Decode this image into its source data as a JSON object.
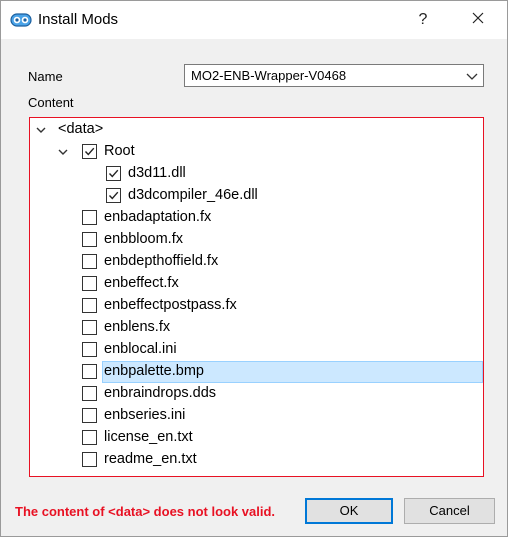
{
  "window": {
    "title": "Install Mods",
    "help_glyph": "?",
    "icon": "mo2-app-icon",
    "close_icon": "close-icon"
  },
  "form": {
    "name_label": "Name",
    "name_value": "MO2-ENB-Wrapper-V0468",
    "content_label": "Content"
  },
  "tree": {
    "items": [
      {
        "label": "<data>",
        "level": 0,
        "expandable": true,
        "expanded": true,
        "checkbox": false
      },
      {
        "label": "Root",
        "level": 1,
        "expandable": true,
        "expanded": true,
        "checkbox": true,
        "checked": true
      },
      {
        "label": "d3d11.dll",
        "level": 2,
        "expandable": false,
        "checkbox": true,
        "checked": true
      },
      {
        "label": "d3dcompiler_46e.dll",
        "level": 2,
        "expandable": false,
        "checkbox": true,
        "checked": true
      },
      {
        "label": "enbadaptation.fx",
        "level": 1,
        "expandable": false,
        "checkbox": true,
        "checked": false
      },
      {
        "label": "enbbloom.fx",
        "level": 1,
        "expandable": false,
        "checkbox": true,
        "checked": false
      },
      {
        "label": "enbdepthoffield.fx",
        "level": 1,
        "expandable": false,
        "checkbox": true,
        "checked": false
      },
      {
        "label": "enbeffect.fx",
        "level": 1,
        "expandable": false,
        "checkbox": true,
        "checked": false
      },
      {
        "label": "enbeffectpostpass.fx",
        "level": 1,
        "expandable": false,
        "checkbox": true,
        "checked": false
      },
      {
        "label": "enblens.fx",
        "level": 1,
        "expandable": false,
        "checkbox": true,
        "checked": false
      },
      {
        "label": "enblocal.ini",
        "level": 1,
        "expandable": false,
        "checkbox": true,
        "checked": false
      },
      {
        "label": "enbpalette.bmp",
        "level": 1,
        "expandable": false,
        "checkbox": true,
        "checked": false,
        "selected": true
      },
      {
        "label": "enbraindrops.dds",
        "level": 1,
        "expandable": false,
        "checkbox": true,
        "checked": false
      },
      {
        "label": "enbseries.ini",
        "level": 1,
        "expandable": false,
        "checkbox": true,
        "checked": false
      },
      {
        "label": "license_en.txt",
        "level": 1,
        "expandable": false,
        "checkbox": true,
        "checked": false
      },
      {
        "label": "readme_en.txt",
        "level": 1,
        "expandable": false,
        "checkbox": true,
        "checked": false
      }
    ]
  },
  "footer": {
    "error_text": "The content of <data> does not look valid.",
    "ok_label": "OK",
    "cancel_label": "Cancel"
  },
  "colors": {
    "error": "#e81123",
    "selection": "#cce8ff",
    "accent": "#0078d7"
  }
}
